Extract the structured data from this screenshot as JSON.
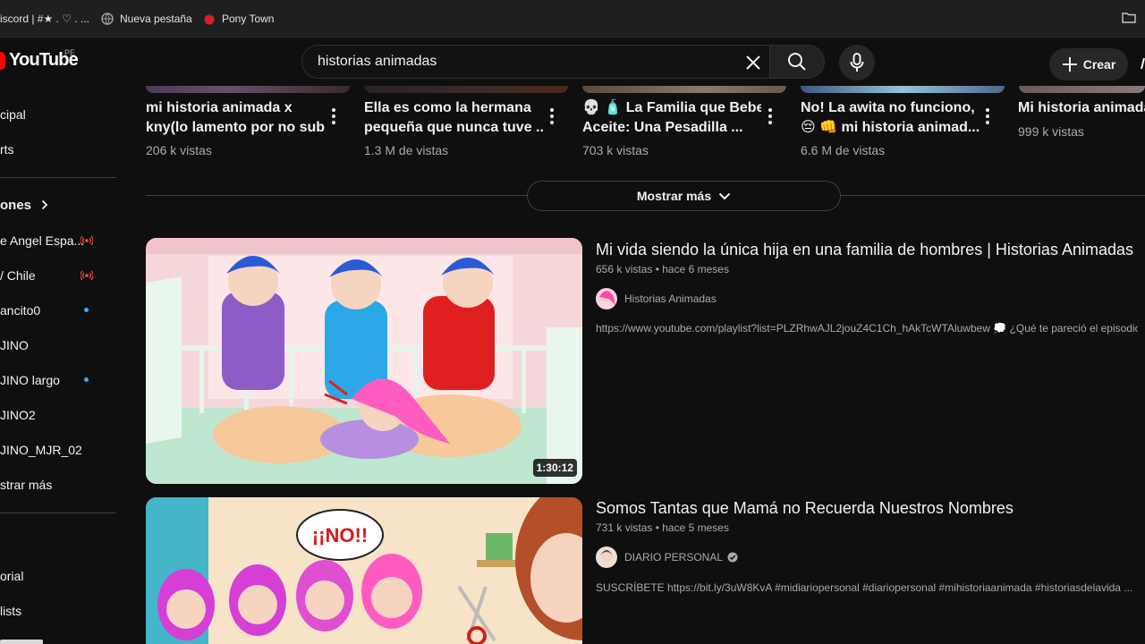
{
  "bookmarks": [
    {
      "label": "iscord | #★ . ♡ . ...",
      "icon": "discord-icon"
    },
    {
      "label": "Nueva pestaña",
      "icon": "globe-icon"
    },
    {
      "label": "Pony Town",
      "icon": "apple-icon"
    }
  ],
  "header": {
    "logo_text": "YouTube",
    "country": "PE",
    "search_value": "historias animadas",
    "create_label": "Crear"
  },
  "sidebar": {
    "items": [
      {
        "label": "cipal"
      },
      {
        "label": "rts"
      },
      {
        "label": "ones"
      },
      {
        "label": "e Angel Espa..."
      },
      {
        "label": "/ Chile"
      },
      {
        "label": "ancito0"
      },
      {
        "label": "JINO"
      },
      {
        "label": "JINO largo"
      },
      {
        "label": "JINO2"
      },
      {
        "label": "JINO_MJR_02"
      },
      {
        "label": "strar más"
      },
      {
        "label": "orial"
      },
      {
        "label": "lists"
      }
    ]
  },
  "shorts": [
    {
      "title_lines": [
        "mi historia animada x",
        "kny(lo lamento por no sub..."
      ],
      "views": "206 k vistas"
    },
    {
      "title_lines": [
        "Ella es como la hermana",
        "pequeña que nunca tuve ..."
      ],
      "views": "1.3 M de vistas"
    },
    {
      "title_lines": [
        "💀 🧴 La Familia que Bebe",
        "Aceite: Una Pesadilla ..."
      ],
      "views": "703 k vistas"
    },
    {
      "title_lines": [
        "No! La awita no funciono,",
        "😔 👊 mi historia animad..."
      ],
      "views": "6.6 M de vistas"
    },
    {
      "title_lines": [
        "Mi historia animada"
      ],
      "views": "999 k vistas"
    }
  ],
  "show_more_label": "Mostrar más",
  "videos": [
    {
      "title": "Mi vida siendo la única hija en una familia de hombres | Historias Animadas",
      "meta": "656 k vistas • hace 6 meses",
      "channel": "Historias Animadas",
      "verified": false,
      "description": "https://www.youtube.com/playlist?list=PLZRhwAJL2jouZ4C1Ch_hAkTcWTAluwbew 💭 ¿Qué te pareció el episodio?",
      "duration": "1:30:12"
    },
    {
      "title": "Somos Tantas que Mamá no Recuerda Nuestros Nombres",
      "meta": "731 k vistas • hace 5 meses",
      "channel": "DIARIO PERSONAL",
      "verified": true,
      "description": "SUSCRÍBETE https://bit.ly/3uW8KvA #midiariopersonal #diariopersonal #mihistoriaanimada #historiasdelavida ...",
      "thumb_text": "¡¡NO!!"
    }
  ],
  "colors": {
    "background": "#0f0f0f",
    "brand_red": "#ff0000",
    "live_red": "#ff4e45",
    "new_blue": "#3ea6ff",
    "secondary_text": "#aaaaaa"
  }
}
